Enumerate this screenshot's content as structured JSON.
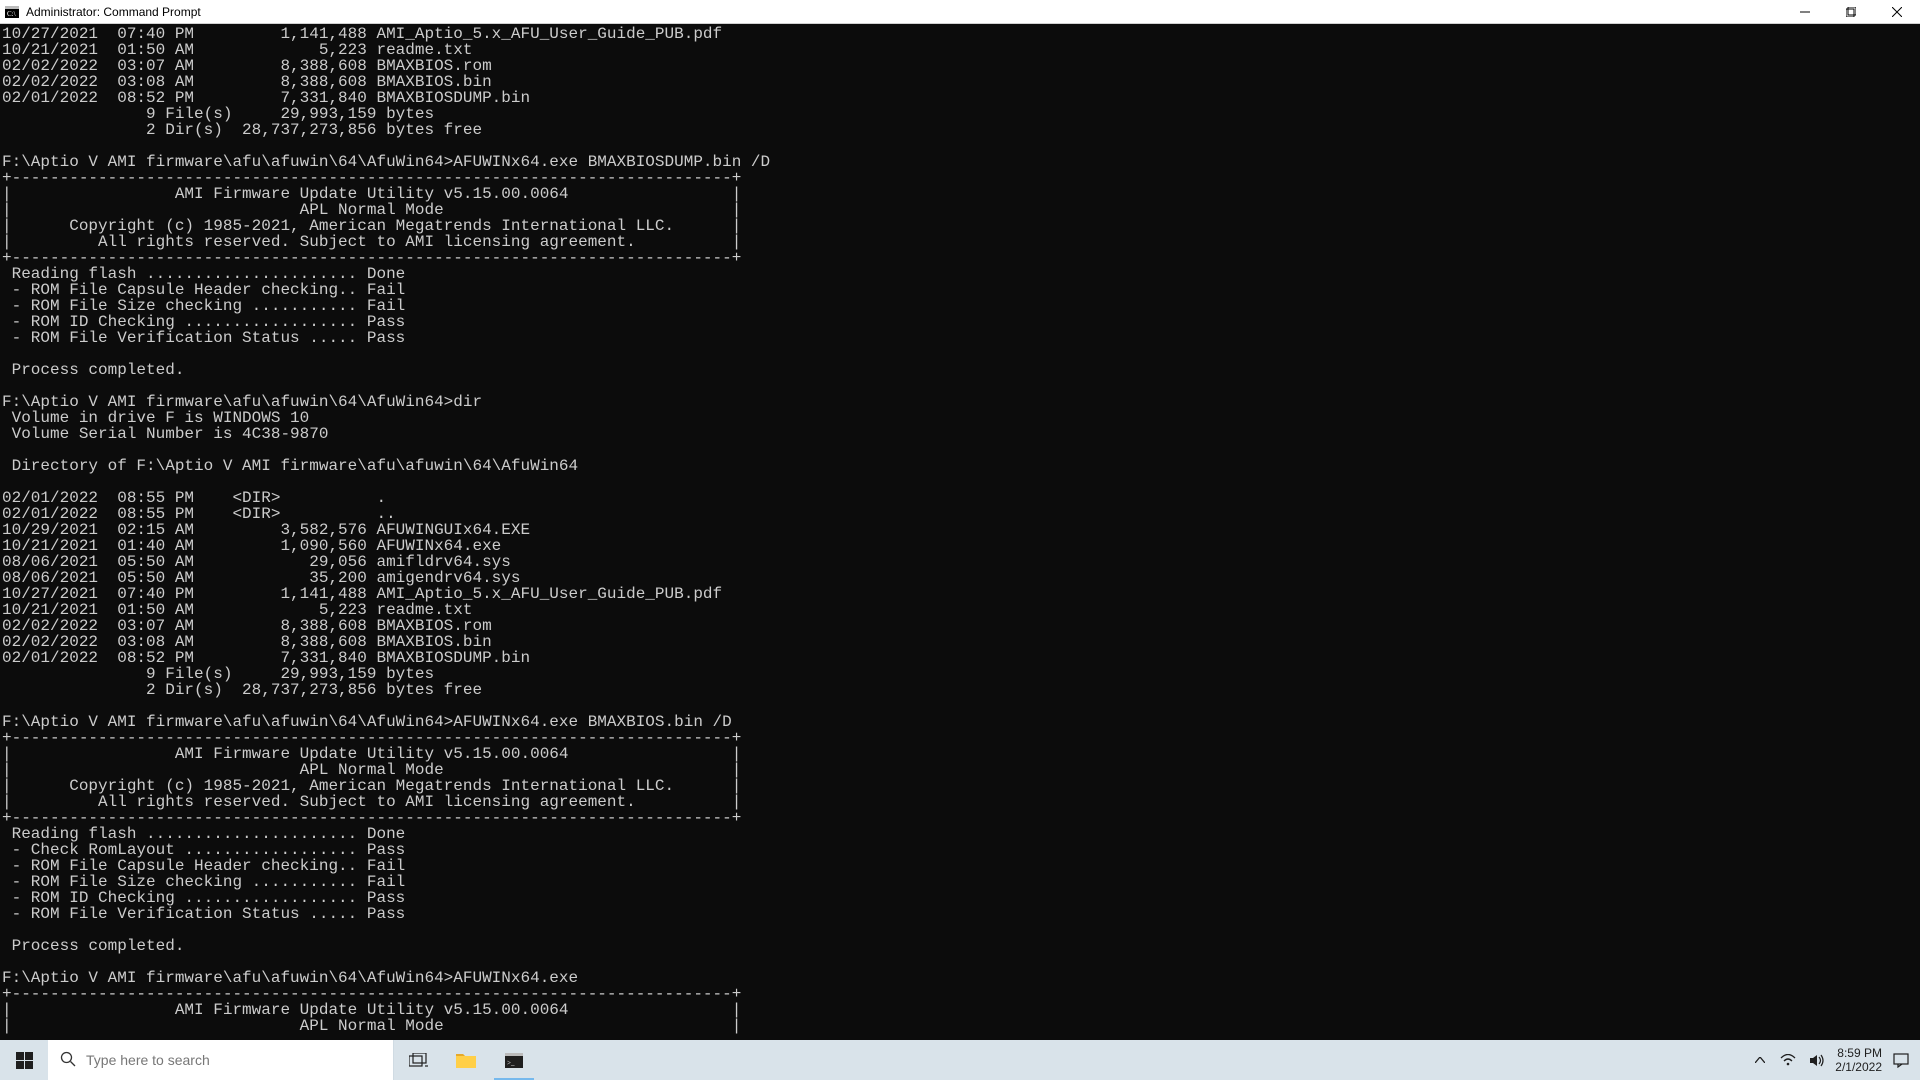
{
  "window": {
    "title": "Administrator: Command Prompt"
  },
  "terminal": {
    "lines": [
      "10/27/2021  07:40 PM         1,141,488 AMI_Aptio_5.x_AFU_User_Guide_PUB.pdf",
      "10/21/2021  01:50 AM             5,223 readme.txt",
      "02/02/2022  03:07 AM         8,388,608 BMAXBIOS.rom",
      "02/02/2022  03:08 AM         8,388,608 BMAXBIOS.bin",
      "02/01/2022  08:52 PM         7,331,840 BMAXBIOSDUMP.bin",
      "               9 File(s)     29,993,159 bytes",
      "               2 Dir(s)  28,737,273,856 bytes free",
      "",
      "F:\\Aptio V AMI firmware\\afu\\afuwin\\64\\AfuWin64>AFUWINx64.exe BMAXBIOSDUMP.bin /D",
      "+---------------------------------------------------------------------------+",
      "|                 AMI Firmware Update Utility v5.15.00.0064                 |",
      "|                              APL Normal Mode                              |",
      "|      Copyright (c) 1985-2021, American Megatrends International LLC.      |",
      "|         All rights reserved. Subject to AMI licensing agreement.          |",
      "+---------------------------------------------------------------------------+",
      " Reading flash ...................... Done",
      " - ROM File Capsule Header checking.. Fail",
      " - ROM File Size checking ........... Fail",
      " - ROM ID Checking .................. Pass",
      " - ROM File Verification Status ..... Pass",
      "",
      " Process completed.",
      "",
      "F:\\Aptio V AMI firmware\\afu\\afuwin\\64\\AfuWin64>dir",
      " Volume in drive F is WINDOWS 10",
      " Volume Serial Number is 4C38-9870",
      "",
      " Directory of F:\\Aptio V AMI firmware\\afu\\afuwin\\64\\AfuWin64",
      "",
      "02/01/2022  08:55 PM    <DIR>          .",
      "02/01/2022  08:55 PM    <DIR>          ..",
      "10/29/2021  02:15 AM         3,582,576 AFUWINGUIx64.EXE",
      "10/21/2021  01:40 AM         1,090,560 AFUWINx64.exe",
      "08/06/2021  05:50 AM            29,056 amifldrv64.sys",
      "08/06/2021  05:50 AM            35,200 amigendrv64.sys",
      "10/27/2021  07:40 PM         1,141,488 AMI_Aptio_5.x_AFU_User_Guide_PUB.pdf",
      "10/21/2021  01:50 AM             5,223 readme.txt",
      "02/02/2022  03:07 AM         8,388,608 BMAXBIOS.rom",
      "02/02/2022  03:08 AM         8,388,608 BMAXBIOS.bin",
      "02/01/2022  08:52 PM         7,331,840 BMAXBIOSDUMP.bin",
      "               9 File(s)     29,993,159 bytes",
      "               2 Dir(s)  28,737,273,856 bytes free",
      "",
      "F:\\Aptio V AMI firmware\\afu\\afuwin\\64\\AfuWin64>AFUWINx64.exe BMAXBIOS.bin /D",
      "+---------------------------------------------------------------------------+",
      "|                 AMI Firmware Update Utility v5.15.00.0064                 |",
      "|                              APL Normal Mode                              |",
      "|      Copyright (c) 1985-2021, American Megatrends International LLC.      |",
      "|         All rights reserved. Subject to AMI licensing agreement.          |",
      "+---------------------------------------------------------------------------+",
      " Reading flash ...................... Done",
      " - Check RomLayout .................. Pass",
      " - ROM File Capsule Header checking.. Fail",
      " - ROM File Size checking ........... Fail",
      " - ROM ID Checking .................. Pass",
      " - ROM File Verification Status ..... Pass",
      "",
      " Process completed.",
      "",
      "F:\\Aptio V AMI firmware\\afu\\afuwin\\64\\AfuWin64>AFUWINx64.exe",
      "+---------------------------------------------------------------------------+",
      "|                 AMI Firmware Update Utility v5.15.00.0064                 |",
      "|                              APL Normal Mode                              |"
    ]
  },
  "taskbar": {
    "search_placeholder": "Type here to search",
    "clock_time": "8:59 PM",
    "clock_date": "2/1/2022"
  }
}
